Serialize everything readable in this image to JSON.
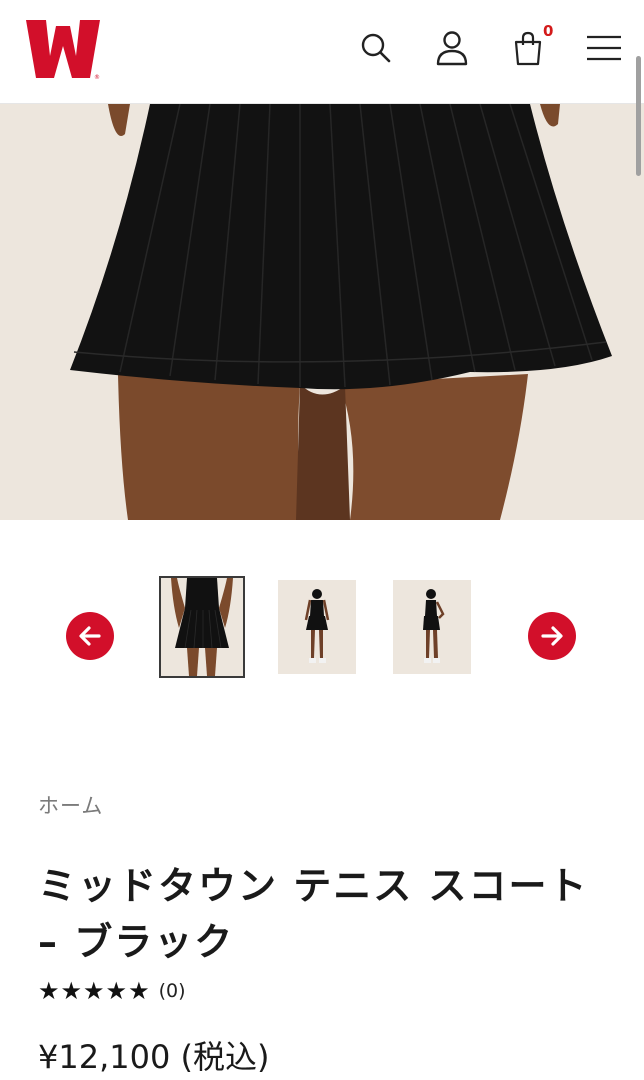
{
  "header": {
    "logo_label": "W",
    "cart_count": "0",
    "icons": [
      "search-icon",
      "user-icon",
      "shopping-bag-icon",
      "hamburger-menu-icon"
    ]
  },
  "colors": {
    "brand_red": "#d20f2a",
    "hero_background": "#ede6dd",
    "text_primary": "#1a1a1a",
    "text_muted": "#7b7b7b"
  },
  "gallery": {
    "main_image": "black pleated tennis skirt on model",
    "thumbnails": [
      {
        "alt": "skirt front close-up",
        "selected": true
      },
      {
        "alt": "model full outfit front",
        "selected": false
      },
      {
        "alt": "model full outfit side",
        "selected": false
      }
    ],
    "prev_icon": "arrow-left-icon",
    "next_icon": "arrow-right-icon"
  },
  "breadcrumb": "ホーム",
  "product": {
    "title": "ミッドタウン テニス スコート – ブラック",
    "stars": "★★★★★",
    "rating_value": 5,
    "review_count": "(0)",
    "price": "¥12,100 (税込)"
  }
}
